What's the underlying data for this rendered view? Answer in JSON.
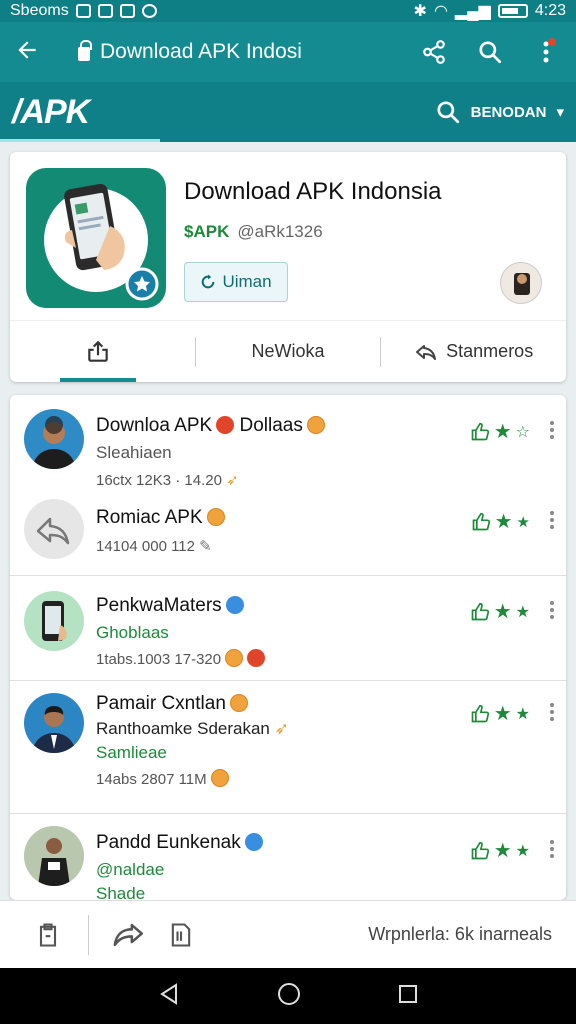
{
  "status": {
    "carrier": "Sbeoms",
    "time": "4:23"
  },
  "appbar": {
    "title": "Download APK Indosi",
    "back_icon": "arrow-left-icon",
    "actions": [
      "share-icon",
      "search-icon",
      "more-vert-icon"
    ]
  },
  "brand": {
    "logo_text": "/APK",
    "search_label": "BENODAN"
  },
  "app": {
    "title": "Download APK Indonsia",
    "tag": "$APK",
    "handle": "@aRk1326",
    "update_label": "Uiman",
    "tabs": [
      {
        "label": "",
        "icon": "share-icon"
      },
      {
        "label": "NeWioka",
        "icon": ""
      },
      {
        "label": "Stanmeros",
        "icon": "reply-icon"
      }
    ]
  },
  "feed": [
    {
      "name": "Downloa APK",
      "name_suffix": "Dollaas",
      "line1": "Sleahiaen",
      "meta": "16ctx 12K3 · 14.20",
      "stars": 2
    },
    {
      "name": "Romiac APK",
      "name_suffix": "",
      "line1": "",
      "meta": "14104 000   112",
      "stars": 2
    },
    {
      "name": "PenkwaMaters",
      "name_suffix": "",
      "line1": "Ghoblaas",
      "meta": "1tabs.1003   17-320",
      "stars": 3
    },
    {
      "name": "Pamair Cxntlan",
      "name_suffix": "",
      "line1": "Ranthoamke Sderakan",
      "line2": "Samlieae",
      "meta": "14abs 2807   11M",
      "stars": 3
    },
    {
      "name": "Pandd Eunkenak",
      "name_suffix": "",
      "line1": "@naldae",
      "line2": "Shade",
      "meta": "",
      "stars": 3
    }
  ],
  "bottombar": {
    "text": "Wrpnlerla: 6k inarneals"
  },
  "colors": {
    "primary": "#138b91",
    "primary_dark": "#0f8088",
    "accent_green": "#1d8a3b"
  }
}
